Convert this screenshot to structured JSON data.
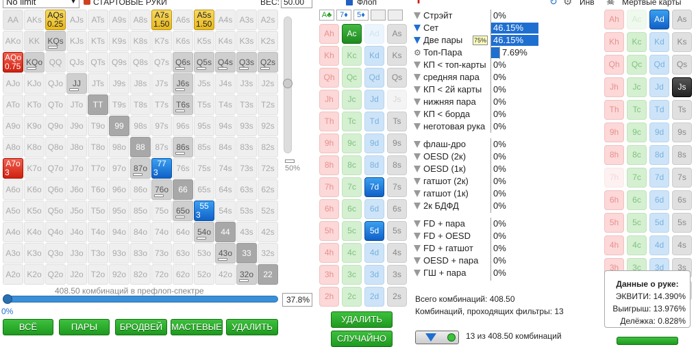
{
  "header": {
    "limit_select": "No limit",
    "starting_hands": "СТАРТОВЫЕ РУКИ",
    "weight_label": "ВЕС:",
    "weight_value": "50.00",
    "flop_label": "Флоп",
    "invert_label": "Инв",
    "dead_cards": "Мертвые карты"
  },
  "matrix": [
    [
      {
        "t": "AA"
      },
      {
        "t": "AKs"
      },
      {
        "t": "AQs",
        "w": "0.25",
        "c": "gold"
      },
      {
        "t": "AJs"
      },
      {
        "t": "ATs"
      },
      {
        "t": "A9s"
      },
      {
        "t": "A8s"
      },
      {
        "t": "A7s",
        "w": "1.50",
        "c": "gold"
      },
      {
        "t": "A6s"
      },
      {
        "t": "A5s",
        "w": "1.50",
        "c": "gold"
      },
      {
        "t": "A4s"
      },
      {
        "t": "A3s"
      },
      {
        "t": "A2s"
      }
    ],
    [
      {
        "t": "AKo"
      },
      {
        "t": "KK"
      },
      {
        "t": "KQs",
        "c": "g1"
      },
      {
        "t": "KJs"
      },
      {
        "t": "KTs"
      },
      {
        "t": "K9s"
      },
      {
        "t": "K8s"
      },
      {
        "t": "K7s"
      },
      {
        "t": "K6s"
      },
      {
        "t": "K5s"
      },
      {
        "t": "K4s"
      },
      {
        "t": "K3s"
      },
      {
        "t": "K2s"
      }
    ],
    [
      {
        "t": "AQo",
        "w": "0.75",
        "c": "red"
      },
      {
        "t": "KQo",
        "c": "g1"
      },
      {
        "t": "QQ"
      },
      {
        "t": "QJs"
      },
      {
        "t": "QTs"
      },
      {
        "t": "Q9s"
      },
      {
        "t": "Q8s"
      },
      {
        "t": "Q7s"
      },
      {
        "t": "Q6s",
        "c": "g1"
      },
      {
        "t": "Q5s",
        "c": "g1"
      },
      {
        "t": "Q4s",
        "c": "g1"
      },
      {
        "t": "Q3s",
        "c": "g1"
      },
      {
        "t": "Q2s",
        "c": "g1"
      }
    ],
    [
      {
        "t": "AJo"
      },
      {
        "t": "KJo"
      },
      {
        "t": "QJo"
      },
      {
        "t": "JJ",
        "c": "g1"
      },
      {
        "t": "JTs"
      },
      {
        "t": "J9s"
      },
      {
        "t": "J8s"
      },
      {
        "t": "J7s"
      },
      {
        "t": "J6s",
        "c": "g1"
      },
      {
        "t": "J5s"
      },
      {
        "t": "J4s"
      },
      {
        "t": "J3s"
      },
      {
        "t": "J2s"
      }
    ],
    [
      {
        "t": "ATo"
      },
      {
        "t": "KTo"
      },
      {
        "t": "QTo"
      },
      {
        "t": "JTo"
      },
      {
        "t": "TT",
        "c": "g2"
      },
      {
        "t": "T9s"
      },
      {
        "t": "T8s"
      },
      {
        "t": "T7s"
      },
      {
        "t": "T6s",
        "c": "g1"
      },
      {
        "t": "T5s"
      },
      {
        "t": "T4s"
      },
      {
        "t": "T3s"
      },
      {
        "t": "T2s"
      }
    ],
    [
      {
        "t": "A9o"
      },
      {
        "t": "K9o"
      },
      {
        "t": "Q9o"
      },
      {
        "t": "J9o"
      },
      {
        "t": "T9o"
      },
      {
        "t": "99",
        "c": "g2"
      },
      {
        "t": "98s"
      },
      {
        "t": "97s"
      },
      {
        "t": "96s"
      },
      {
        "t": "95s"
      },
      {
        "t": "94s"
      },
      {
        "t": "93s"
      },
      {
        "t": "92s"
      }
    ],
    [
      {
        "t": "A8o"
      },
      {
        "t": "K8o"
      },
      {
        "t": "Q8o"
      },
      {
        "t": "J8o"
      },
      {
        "t": "T8o"
      },
      {
        "t": "98o"
      },
      {
        "t": "88",
        "c": "g2"
      },
      {
        "t": "87s"
      },
      {
        "t": "86s",
        "c": "g1"
      },
      {
        "t": "85s"
      },
      {
        "t": "84s"
      },
      {
        "t": "83s"
      },
      {
        "t": "82s"
      }
    ],
    [
      {
        "t": "A7o",
        "w": "3",
        "c": "red"
      },
      {
        "t": "K7o"
      },
      {
        "t": "Q7o"
      },
      {
        "t": "J7o"
      },
      {
        "t": "T7o"
      },
      {
        "t": "97o"
      },
      {
        "t": "87o",
        "c": "g1"
      },
      {
        "t": "77",
        "w": "3",
        "c": "blue"
      },
      {
        "t": "76s"
      },
      {
        "t": "75s"
      },
      {
        "t": "74s"
      },
      {
        "t": "73s"
      },
      {
        "t": "72s"
      }
    ],
    [
      {
        "t": "A6o"
      },
      {
        "t": "K6o"
      },
      {
        "t": "Q6o"
      },
      {
        "t": "J6o"
      },
      {
        "t": "T6o"
      },
      {
        "t": "96o"
      },
      {
        "t": "86o"
      },
      {
        "t": "76o",
        "c": "g1"
      },
      {
        "t": "66",
        "c": "g2"
      },
      {
        "t": "65s"
      },
      {
        "t": "64s"
      },
      {
        "t": "63s"
      },
      {
        "t": "62s"
      }
    ],
    [
      {
        "t": "A5o"
      },
      {
        "t": "K5o"
      },
      {
        "t": "Q5o"
      },
      {
        "t": "J5o"
      },
      {
        "t": "T5o"
      },
      {
        "t": "95o"
      },
      {
        "t": "85o"
      },
      {
        "t": "75o"
      },
      {
        "t": "65o",
        "c": "g1"
      },
      {
        "t": "55",
        "w": "3",
        "c": "blue"
      },
      {
        "t": "54s"
      },
      {
        "t": "53s"
      },
      {
        "t": "52s"
      }
    ],
    [
      {
        "t": "A4o"
      },
      {
        "t": "K4o"
      },
      {
        "t": "Q4o"
      },
      {
        "t": "J4o"
      },
      {
        "t": "T4o"
      },
      {
        "t": "94o"
      },
      {
        "t": "84o"
      },
      {
        "t": "74o"
      },
      {
        "t": "64o"
      },
      {
        "t": "54o",
        "c": "g1"
      },
      {
        "t": "44",
        "c": "g2"
      },
      {
        "t": "43s"
      },
      {
        "t": "42s"
      }
    ],
    [
      {
        "t": "A3o"
      },
      {
        "t": "K3o"
      },
      {
        "t": "Q3o"
      },
      {
        "t": "J3o"
      },
      {
        "t": "T3o"
      },
      {
        "t": "93o"
      },
      {
        "t": "83o"
      },
      {
        "t": "73o"
      },
      {
        "t": "63o"
      },
      {
        "t": "53o"
      },
      {
        "t": "43o",
        "c": "g1"
      },
      {
        "t": "33",
        "c": "g2"
      },
      {
        "t": "32s"
      }
    ],
    [
      {
        "t": "A2o"
      },
      {
        "t": "K2o"
      },
      {
        "t": "Q2o"
      },
      {
        "t": "J2o"
      },
      {
        "t": "T2o"
      },
      {
        "t": "92o"
      },
      {
        "t": "82o"
      },
      {
        "t": "72o"
      },
      {
        "t": "62o"
      },
      {
        "t": "52o"
      },
      {
        "t": "42o"
      },
      {
        "t": "32o",
        "c": "g1"
      },
      {
        "t": "22",
        "c": "g2"
      }
    ]
  ],
  "slider": {
    "pct_label": "50%",
    "weight_fraction": 0.5
  },
  "range": {
    "combos_text": "408.50 комбинаций в префлоп-спектре",
    "percent": "37.8%",
    "left_pct": "0%",
    "fill_fraction": 1.0
  },
  "buttons": {
    "all": "ВСЁ",
    "pairs": "ПАРЫ",
    "broadway": "БРОДВЕЙ",
    "suited": "МАСТЕВЫЕ",
    "delete": "УДАЛИТЬ",
    "delete2": "УДАЛИТЬ",
    "random": "СЛУЧАЙНО"
  },
  "flop_suits": [
    "A♣",
    "7♦",
    "5♦",
    "",
    ""
  ],
  "ranks": [
    "A",
    "K",
    "Q",
    "J",
    "T",
    "9",
    "8",
    "7",
    "6",
    "5",
    "4",
    "3",
    "2"
  ],
  "suits": [
    "h",
    "c",
    "d",
    "s"
  ],
  "board_selected": {
    "Ac": "sel-c",
    "7d": "sel-d",
    "5d": "sel-d"
  },
  "board_dim": [
    "Ad",
    "Js"
  ],
  "dead_selected": {
    "Ad": "sel-d",
    "Js": "sel-s"
  },
  "dead_dim": [
    "Ac",
    "7h"
  ],
  "stats": [
    {
      "label": "Стрэйт",
      "val": "0%",
      "bar": 0
    },
    {
      "label": "Сет",
      "val": "46.15%",
      "bar": 0.4615
    },
    {
      "label": "Две пары",
      "val": "46.15%",
      "bar": 0.4615,
      "tag": "75%"
    },
    {
      "label": "Топ-Пара",
      "val": "7.69%",
      "bar": 0.0769,
      "gear": true
    },
    {
      "label": "КП < топ-карты",
      "val": "0%",
      "bar": 0
    },
    {
      "label": "средняя пара",
      "val": "0%",
      "bar": 0
    },
    {
      "label": "КП < 2й карты",
      "val": "0%",
      "bar": 0
    },
    {
      "label": "нижняя пара",
      "val": "0%",
      "bar": 0
    },
    {
      "label": "КП < борда",
      "val": "0%",
      "bar": 0
    },
    {
      "label": "неготовая рука",
      "val": "0%",
      "bar": 0
    },
    {
      "label": "флаш-дро",
      "val": "0%",
      "bar": 0
    },
    {
      "label": "OESD (2к)",
      "val": "0%",
      "bar": 0
    },
    {
      "label": "OESD (1к)",
      "val": "0%",
      "bar": 0
    },
    {
      "label": "гатшот (2к)",
      "val": "0%",
      "bar": 0
    },
    {
      "label": "гатшот (1к)",
      "val": "0%",
      "bar": 0
    },
    {
      "label": "2к БДФД",
      "val": "0%",
      "bar": 0
    },
    {
      "label": "FD + пара",
      "val": "0%",
      "bar": 0
    },
    {
      "label": "FD + OESD",
      "val": "0%",
      "bar": 0
    },
    {
      "label": "FD + гатшот",
      "val": "0%",
      "bar": 0
    },
    {
      "label": "OESD + пара",
      "val": "0%",
      "bar": 0
    },
    {
      "label": "ГШ + пара",
      "val": "0%",
      "bar": 0
    }
  ],
  "totals": {
    "all": "Всего комбинаций: 408.50",
    "passing": "Комбинаций, проходящих фильтры: 13",
    "footer": "13 из 408.50 комбинаций"
  },
  "info": {
    "title": "Данные о руке:",
    "equity": "ЭКВИТИ: 14.390%",
    "win": "Выигрыш: 13.976%",
    "split": "Делёжка: 0.828%"
  },
  "colors": {
    "accent_blue": "#1f6fd0",
    "green_btn": "#1e9a1e",
    "gold": "#e8b820",
    "red": "#d02010"
  }
}
